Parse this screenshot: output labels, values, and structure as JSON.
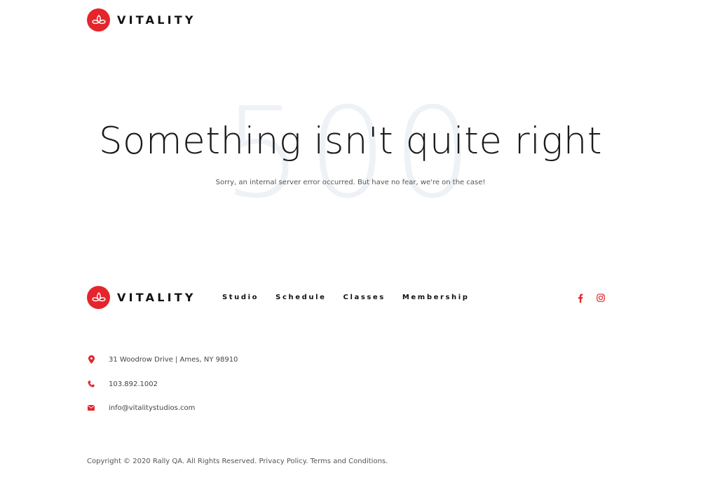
{
  "brand": {
    "name": "VITALITY",
    "accent_color": "#e4252b"
  },
  "hero": {
    "code": "500",
    "headline": "Something isn't quite right",
    "subline": "Sorry, an internal server error occurred. But have no fear, we're on the case!"
  },
  "footer": {
    "nav": [
      {
        "label": "Studio"
      },
      {
        "label": "Schedule"
      },
      {
        "label": "Classes"
      },
      {
        "label": "Membership"
      }
    ],
    "social": [
      {
        "icon": "facebook-icon"
      },
      {
        "icon": "instagram-icon"
      }
    ],
    "contact": {
      "address": "31 Woodrow Drive | Ames, NY 98910",
      "phone": "103.892.1002",
      "email": "info@vitalitystudios.com"
    },
    "copyright": {
      "text": "Copyright © 2020 Rally QA. All Rights Reserved.",
      "privacy": "Privacy Policy.",
      "terms": "Terms and Conditions."
    }
  }
}
